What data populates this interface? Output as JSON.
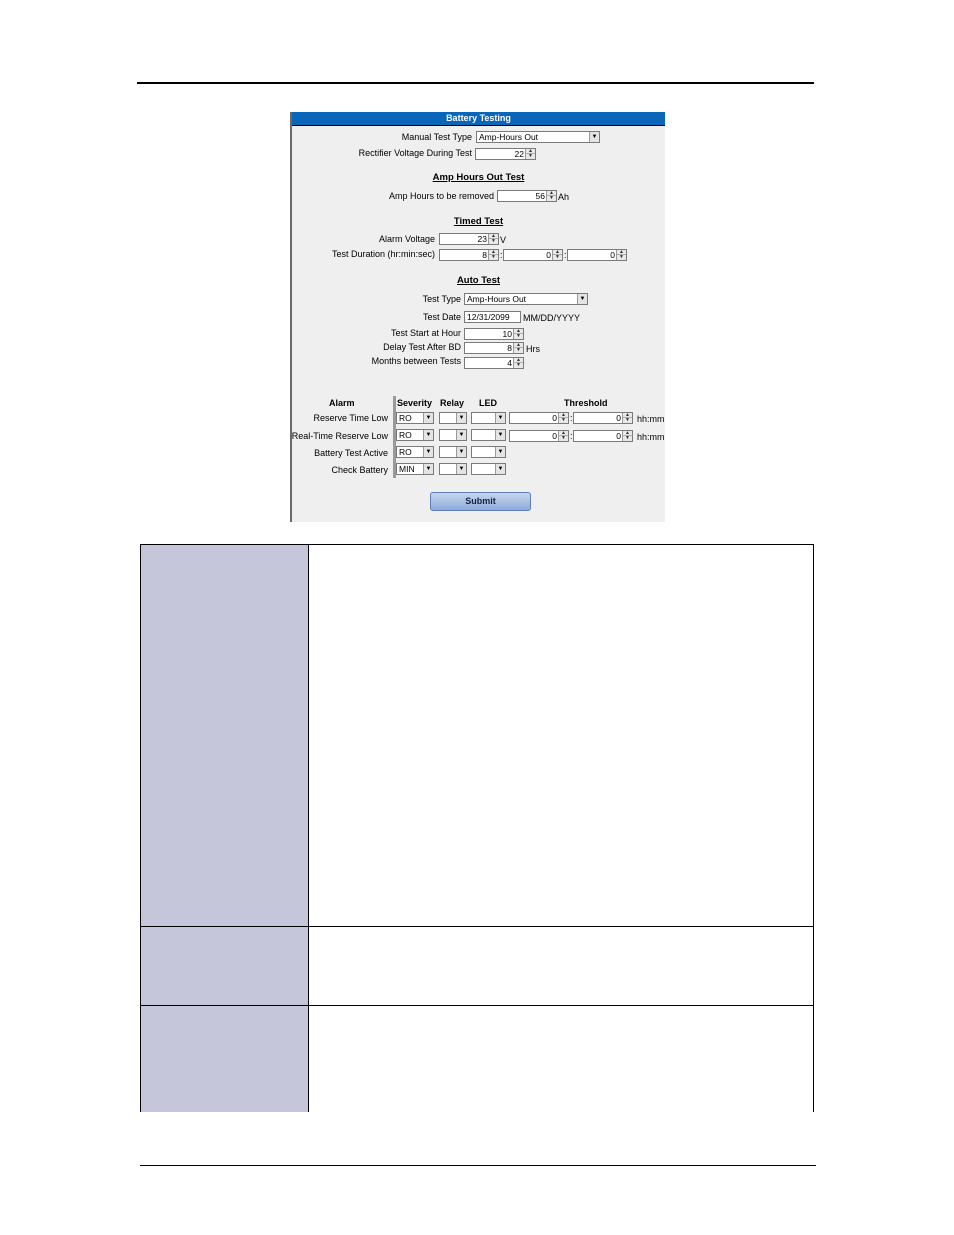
{
  "panel": {
    "title": "Battery Testing",
    "manual_test_type": {
      "label": "Manual Test Type",
      "value": "Amp-Hours Out"
    },
    "rectifier_voltage": {
      "label": "Rectifier Voltage During Test",
      "value": "22"
    },
    "amp_hours_section": {
      "title": "Amp Hours Out Test",
      "amp_hours_removed": {
        "label": "Amp Hours to be removed",
        "value": "56",
        "unit": "Ah"
      }
    },
    "timed_section": {
      "title": "Timed Test",
      "alarm_voltage": {
        "label": "Alarm Voltage",
        "value": "23",
        "unit": "V"
      },
      "test_duration": {
        "label": "Test Duration (hr:min:sec)",
        "hr": "8",
        "min": "0",
        "sec": "0",
        "sep1": ":",
        "sep2": ":"
      }
    },
    "auto_section": {
      "title": "Auto Test",
      "test_type": {
        "label": "Test Type",
        "value": "Amp-Hours Out"
      },
      "test_date": {
        "label": "Test Date",
        "value": "12/31/2099",
        "format": "MM/DD/YYYY"
      },
      "start_hour": {
        "label": "Test Start at Hour",
        "value": "10"
      },
      "delay_after_bd": {
        "label": "Delay Test After BD",
        "value": "8",
        "unit": "Hrs"
      },
      "months_between": {
        "label": "Months between Tests",
        "value": "4"
      }
    },
    "alarm_table": {
      "headers": {
        "alarm": "Alarm",
        "severity": "Severity",
        "relay": "Relay",
        "led": "LED",
        "threshold": "Threshold"
      },
      "rows": [
        {
          "name": "Reserve Time Low",
          "severity": "RO",
          "relay": "",
          "led": "",
          "th1": "0",
          "th2": "0",
          "sep": ":",
          "unit": "hh:mm"
        },
        {
          "name": "Real-Time Reserve Low",
          "severity": "RO",
          "relay": "",
          "led": "",
          "th1": "0",
          "th2": "0",
          "sep": ":",
          "unit": "hh:mm"
        },
        {
          "name": "Battery Test Active",
          "severity": "RO",
          "relay": "",
          "led": ""
        },
        {
          "name": "Check Battery",
          "severity": "MIN",
          "relay": "",
          "led": ""
        }
      ]
    },
    "submit_label": "Submit"
  },
  "colors": {
    "header_bar": "#0a66b8",
    "panel_bg": "#efefef",
    "label_cell": "#c5c6d9"
  },
  "icons": {
    "spinner": "up-down-arrows-icon",
    "dropdown": "chevron-down-icon"
  }
}
